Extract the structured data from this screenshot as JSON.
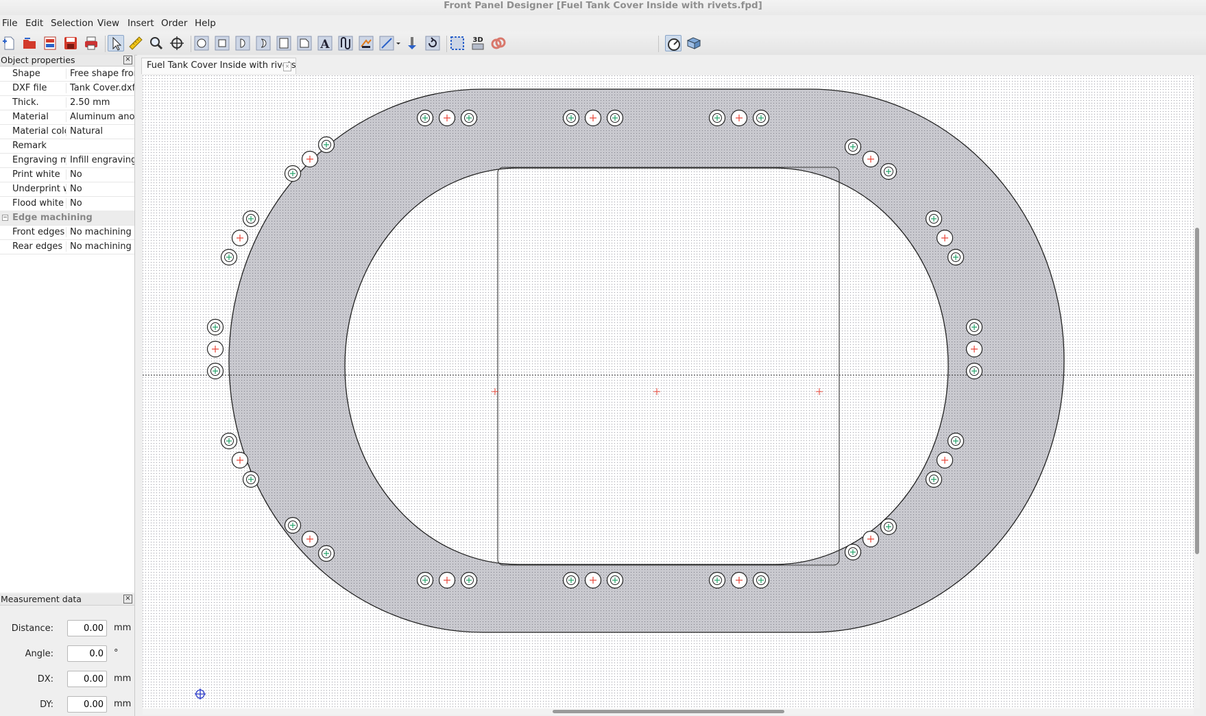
{
  "window": {
    "title": "Front Panel Designer [Fuel Tank Cover Inside with rivets.fpd]"
  },
  "menu": [
    "File",
    "Edit",
    "Selection",
    "View",
    "Insert",
    "Order",
    "Help"
  ],
  "toolbar": {
    "three_d_label": "3D",
    "text_label": "A",
    "icons": [
      "new-file-icon",
      "open-folder-icon",
      "open-recent-icon",
      "save-icon",
      "print-icon",
      "select-pointer-icon",
      "measure-ruler-icon",
      "zoom-icon",
      "crosshair-icon",
      "round-hole-icon",
      "rect-hole-icon",
      "d-hole-icon",
      "double-d-hole-icon",
      "rect-cutout-icon",
      "free-contour-icon",
      "text-engraving-icon",
      "curve-engraving-icon",
      "graphic-icon",
      "line-tool-icon",
      "drill-icon",
      "rotate-icon",
      "frame-icon",
      "three-d-view-icon",
      "link-icon",
      "gauge-icon",
      "price-icon"
    ]
  },
  "properties_panel": {
    "title": "Object properties",
    "rows": [
      {
        "key": "Shape",
        "value": "Free shape from"
      },
      {
        "key": "DXF file",
        "value": "Tank Cover.dxf"
      },
      {
        "key": "Thick.",
        "value": "2.50 mm"
      },
      {
        "key": "Material",
        "value": "Aluminum anod"
      },
      {
        "key": "Material colo",
        "value": "Natural"
      },
      {
        "key": "Remark",
        "value": ""
      },
      {
        "key": "Engraving m",
        "value": "Infill engraving"
      },
      {
        "key": "Print white",
        "value": "No"
      },
      {
        "key": "Underprint w",
        "value": "No"
      },
      {
        "key": "Flood white",
        "value": "No"
      }
    ],
    "group": {
      "expander": "−",
      "label": "Edge machining"
    },
    "group_rows": [
      {
        "key": "Front edges",
        "value": "No machining"
      },
      {
        "key": "Rear edges",
        "value": "No machining"
      }
    ]
  },
  "measurement_panel": {
    "title": "Measurement data",
    "fields": [
      {
        "label": "Distance:",
        "value": "0.00",
        "unit": "mm"
      },
      {
        "label": "Angle:",
        "value": "0.0",
        "unit": "°"
      },
      {
        "label": "DX:",
        "value": "0.00",
        "unit": "mm"
      },
      {
        "label": "DY:",
        "value": "0.00",
        "unit": "mm"
      }
    ]
  },
  "document_tab": {
    "label": "Fuel Tank Cover Inside with rivets.fpd"
  },
  "colors": {
    "panel_fill": "#c9c9cf",
    "hole_center": "#e8473a",
    "rivet_center": "#24a36b",
    "cursor_marker": "#2838c8"
  }
}
